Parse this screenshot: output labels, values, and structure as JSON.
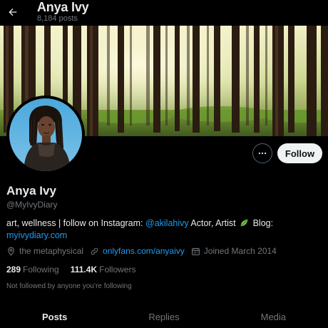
{
  "header": {
    "title": "Anya Ivy",
    "post_count": "8,184 posts"
  },
  "profile": {
    "name": "Anya Ivy",
    "handle": "@MyIvyDiary",
    "bio": {
      "text_1": "art, wellness | follow on Instagram: ",
      "instagram": "@akilahivy",
      "text_2": " Actor, Artist",
      "text_3": " Blog:",
      "blog_link": "myivydiary.com"
    },
    "location": "the metaphysical",
    "website": "onlyfans.com/anyaivy",
    "joined": "Joined March 2014",
    "following_count": "289",
    "following_label": "Following",
    "followers_count": "111.4K",
    "followers_label": "Followers",
    "followed_note": "Not followed by anyone you’re following"
  },
  "actions": {
    "follow_label": "Follow"
  },
  "tabs": [
    {
      "label": "Posts",
      "active": true
    },
    {
      "label": "Replies",
      "active": false
    },
    {
      "label": "Media",
      "active": false
    }
  ],
  "colors": {
    "background": "#000000",
    "text_primary": "#e7e9ea",
    "text_secondary": "#71767b",
    "link": "#1d9bf0",
    "follow_button_bg": "#eff3f4"
  }
}
